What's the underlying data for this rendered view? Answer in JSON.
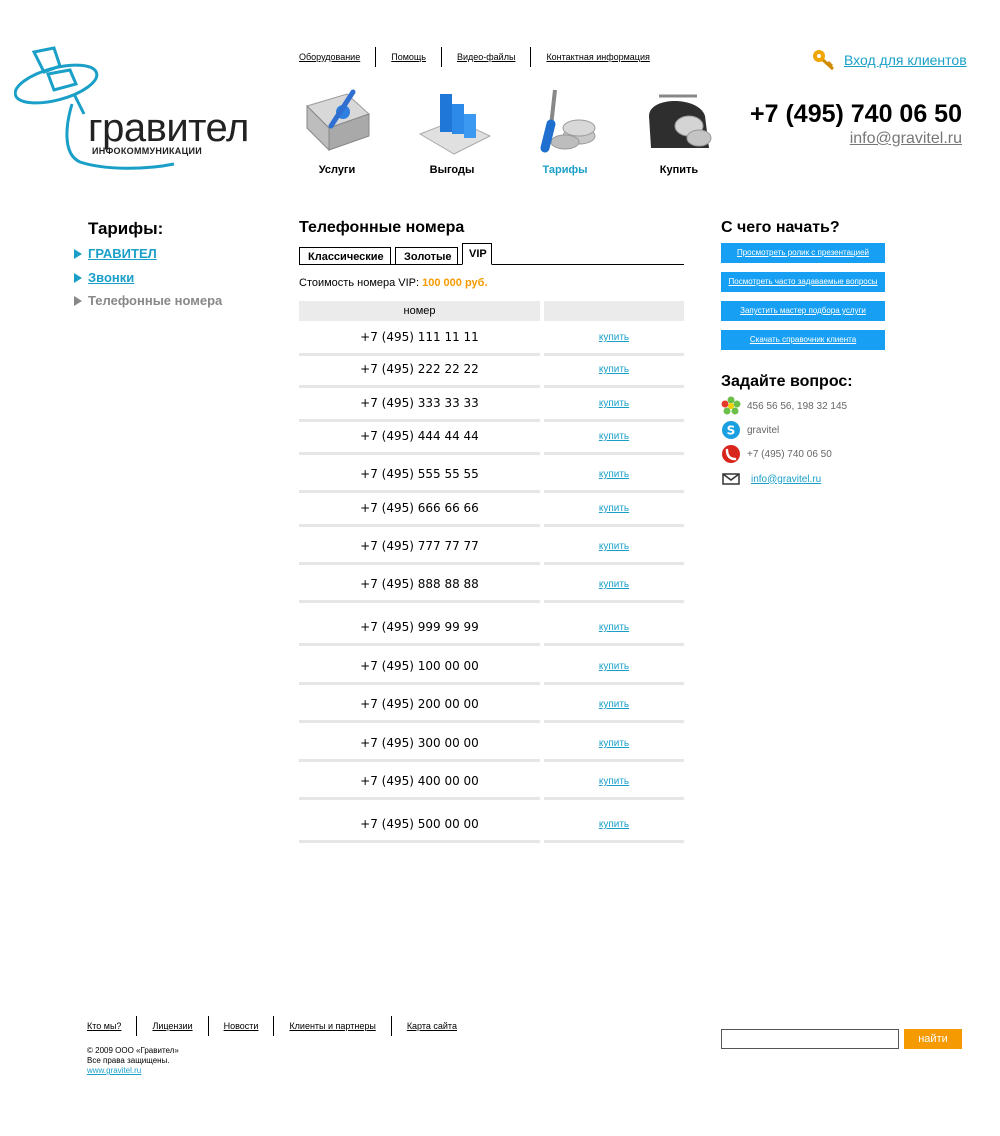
{
  "logo": {
    "brand": "гравител",
    "subtitle": "ИНФОКОММУНИКАЦИИ"
  },
  "top_nav": [
    "Оборудование",
    "Помощь",
    "Видео-файлы",
    "Контактная информация"
  ],
  "login_label": "Вход для клиентов",
  "header_phone": "+7 (495) 740 06 50",
  "header_email": "info@gravitel.ru",
  "icon_nav": [
    {
      "label": "Услуги",
      "icon": "book-icon",
      "active": false
    },
    {
      "label": "Выгоды",
      "icon": "bar-chart-icon",
      "active": false
    },
    {
      "label": "Тарифы",
      "icon": "tools-coins-icon",
      "active": true
    },
    {
      "label": "Купить",
      "icon": "wallet-icon",
      "active": false
    }
  ],
  "left_sidebar": {
    "title": "Тарифы:",
    "items": [
      {
        "label": "ГРАВИТЕЛ",
        "current": false
      },
      {
        "label": "Звонки",
        "current": false
      },
      {
        "label": "Телефонные номера",
        "current": true
      }
    ]
  },
  "main": {
    "title": "Телефонные номера",
    "tabs": [
      "Классические",
      "Золотые",
      "VIP"
    ],
    "active_tab": "VIP",
    "price_label": "Стоимость номера VIP:",
    "price_value": "100 000 руб.",
    "table_header": "номер",
    "buy_label": "купить",
    "numbers": [
      "+7 (495) 111 11 11",
      "+7 (495) 222 22 22",
      "+7 (495) 333 33 33",
      "+7 (495) 444 44 44",
      "+7 (495) 555 55 55",
      "+7 (495) 666 66 66",
      "+7 (495) 777 77 77",
      "+7 (495) 888 88 88",
      "+7 (495) 999 99 99",
      "+7 (495) 100 00 00",
      "+7 (495) 200 00 00",
      "+7 (495) 300 00 00",
      "+7 (495) 400 00 00",
      "+7 (495) 500 00 00"
    ]
  },
  "right_sidebar": {
    "title": "С чего начать?",
    "buttons": [
      "Просмотреть ролик с презентацией",
      "Посмотреть часто задаваемые вопросы",
      "Запустить мастер подбора услуги",
      "Скачать справочник клиента"
    ],
    "ask_title": "Задайте вопрос:",
    "contacts": {
      "icq": "456 56 56, 198 32 145",
      "skype": "gravitel",
      "phone": "+7 (495) 740 06 50",
      "email": "info@gravitel.ru"
    }
  },
  "footer": {
    "nav": [
      "Кто мы?",
      "Лицензии",
      "Новости",
      "Клиенты и партнеры",
      "Карта сайта"
    ],
    "copyright_1": "© 2009 ООО «Гравител»",
    "copyright_2": "Все права защищены.",
    "site": "www.gravitel.ru",
    "search_value": "",
    "search_button": "найти"
  },
  "colors": {
    "accent": "#1aa0c8",
    "button_blue": "#17a0f3",
    "orange": "#f59a00",
    "row_line": "#e6e6e6",
    "header_bg": "#ebebeb"
  }
}
